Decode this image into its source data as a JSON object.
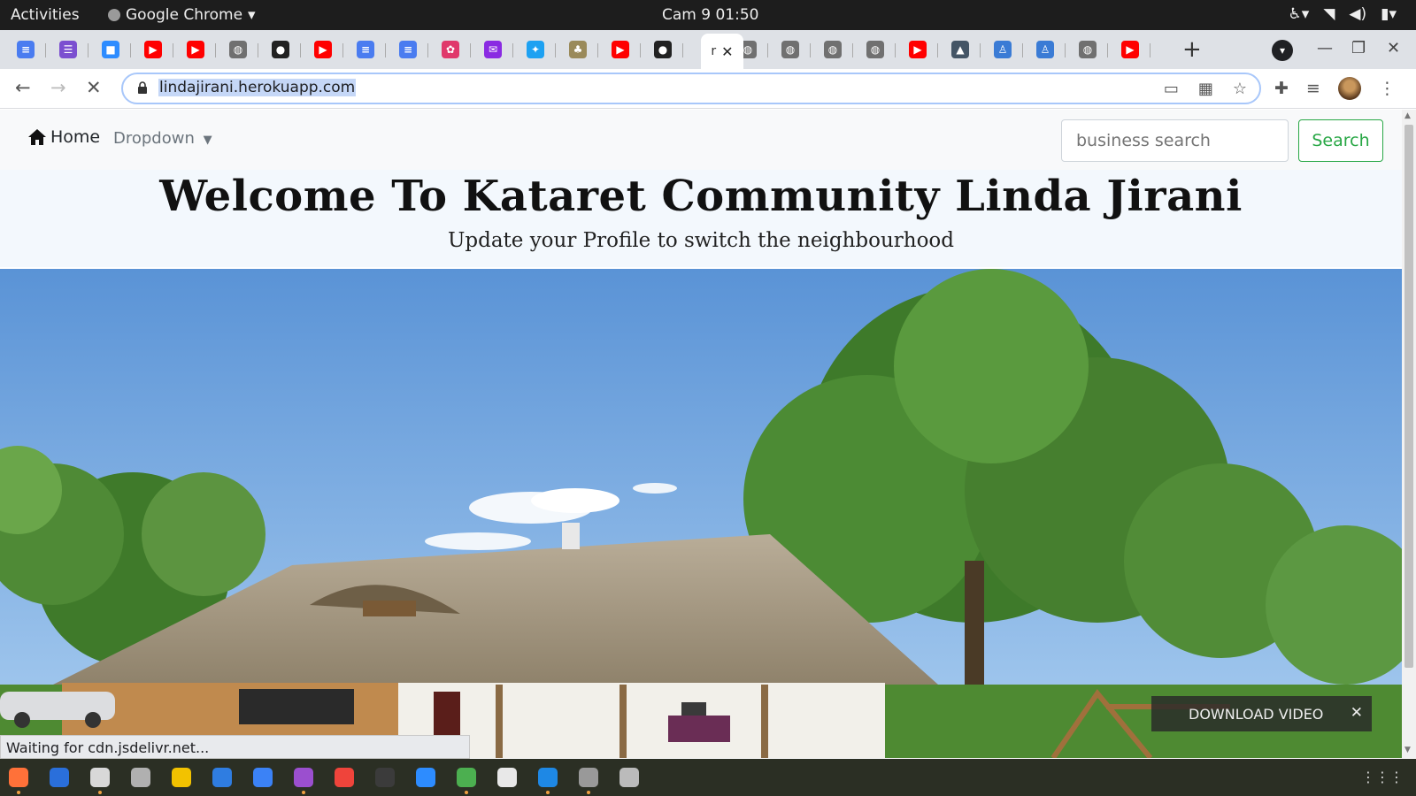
{
  "topbar": {
    "activities": "Activities",
    "app_name": "Google Chrome",
    "clock": "Cam 9  01:50"
  },
  "tabs": [
    {
      "icon": "docs-icon",
      "color": "#4a7cf0"
    },
    {
      "icon": "forms-icon",
      "color": "#7b4fd0"
    },
    {
      "icon": "zoom-icon",
      "color": "#2d8cff"
    },
    {
      "icon": "youtube-icon",
      "color": "#ff0000"
    },
    {
      "icon": "youtube-icon",
      "color": "#ff0000"
    },
    {
      "icon": "globe-icon",
      "color": "#707070"
    },
    {
      "icon": "github-icon",
      "color": "#222222"
    },
    {
      "icon": "youtube-icon",
      "color": "#ff0000"
    },
    {
      "icon": "docs-icon",
      "color": "#4a7cf0"
    },
    {
      "icon": "docs-icon",
      "color": "#4a7cf0"
    },
    {
      "icon": "openai-icon",
      "color": "#e0386b"
    },
    {
      "icon": "mail-icon",
      "color": "#8a2be2"
    },
    {
      "icon": "twitter-icon",
      "color": "#1da1f2"
    },
    {
      "icon": "plant-icon",
      "color": "#9a8a5a"
    },
    {
      "icon": "youtube-icon",
      "color": "#ff0000"
    },
    {
      "icon": "github-icon",
      "color": "#222222"
    },
    {
      "icon": "globe-icon",
      "color": "#707070"
    },
    {
      "icon": "globe-icon",
      "color": "#707070"
    },
    {
      "icon": "globe-icon",
      "color": "#707070"
    },
    {
      "icon": "globe-icon",
      "color": "#707070"
    },
    {
      "icon": "youtube-icon",
      "color": "#ff0000"
    },
    {
      "icon": "graduation-cap-icon",
      "color": "#445566"
    },
    {
      "icon": "buddha-icon",
      "color": "#3a7bd5"
    },
    {
      "icon": "buddha-icon",
      "color": "#3a7bd5"
    },
    {
      "icon": "globe-icon",
      "color": "#707070"
    },
    {
      "icon": "youtube-icon",
      "color": "#ff0000"
    }
  ],
  "active_tab": {
    "label": "r"
  },
  "address": {
    "url": "lindajirani.herokuapp.com"
  },
  "navbar": {
    "home": "Home",
    "dropdown": "Dropdown",
    "search_placeholder": "business search",
    "search_button": "Search"
  },
  "hero": {
    "title": "Welcome To Kataret Community Linda Jirani",
    "subtitle": "Update your Profile to switch the neighbourhood"
  },
  "status_text": "Waiting for cdn.jsdelivr.net...",
  "download_video": {
    "label": "DOWNLOAD VIDEO"
  },
  "dock": [
    {
      "icon": "firefox-icon",
      "color": "#ff7139",
      "running": true
    },
    {
      "icon": "thunderbird-icon",
      "color": "#2a6fdb",
      "running": false
    },
    {
      "icon": "files-icon",
      "color": "#d8d8d8",
      "running": true
    },
    {
      "icon": "screenshot-icon",
      "color": "#b0b0b0",
      "running": false
    },
    {
      "icon": "rhythmbox-icon",
      "color": "#f2c200",
      "running": false
    },
    {
      "icon": "writer-icon",
      "color": "#2f7de1",
      "running": false
    },
    {
      "icon": "help-icon",
      "color": "#3b82f6",
      "running": false
    },
    {
      "icon": "videos-icon",
      "color": "#9b4fcf",
      "running": true
    },
    {
      "icon": "anydesk-icon",
      "color": "#ef443b",
      "running": false
    },
    {
      "icon": "terminal-icon",
      "color": "#3b3b3b",
      "running": false
    },
    {
      "icon": "zoom-icon",
      "color": "#2d8cff",
      "running": false
    },
    {
      "icon": "chrome-icon",
      "color": "#4caf50",
      "running": true
    },
    {
      "icon": "document-viewer-icon",
      "color": "#e8e8e8",
      "running": false
    },
    {
      "icon": "vscode-icon",
      "color": "#1e88e5",
      "running": true
    },
    {
      "icon": "usb-drive-icon",
      "color": "#999999",
      "running": true
    },
    {
      "icon": "usb-drive-icon",
      "color": "#bbbbbb",
      "running": false
    }
  ]
}
